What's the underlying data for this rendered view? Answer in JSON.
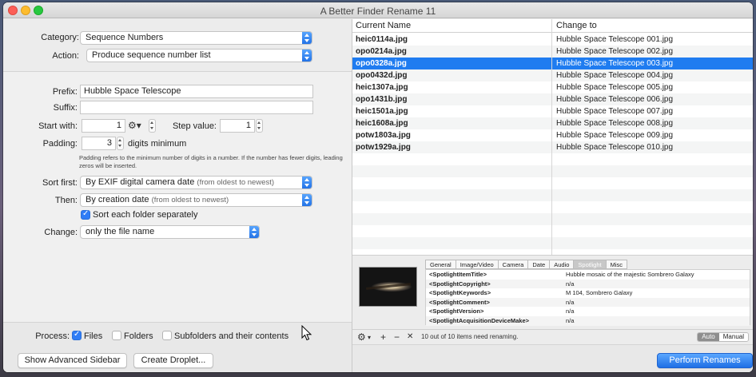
{
  "window": {
    "title": "A Better Finder Rename 11"
  },
  "top": {
    "category_label": "Category:",
    "category_value": "Sequence Numbers",
    "action_label": "Action:",
    "action_value": "Produce sequence number list"
  },
  "options": {
    "prefix_label": "Prefix:",
    "prefix_value": "Hubble Space Telescope",
    "suffix_label": "Suffix:",
    "suffix_value": "",
    "start_label": "Start with:",
    "start_value": "1",
    "step_label": "Step value:",
    "step_value": "1",
    "padding_label": "Padding:",
    "padding_value": "3",
    "padding_unit": "digits minimum",
    "padding_note": "Padding refers to the minimum number of digits in a number. If the number has fewer digits, leading zeros will be inserted.",
    "sort_first_label": "Sort first:",
    "sort_first_value": "By EXIF digital camera date",
    "sort_first_sub": "(from oldest to newest)",
    "then_label": "Then:",
    "then_value": "By creation date",
    "then_sub": "(from oldest to newest)",
    "sort_folder_label": "Sort each folder separately",
    "sort_folder_checked": true,
    "change_label": "Change:",
    "change_value": "only the file name"
  },
  "process": {
    "label": "Process:",
    "files_label": "Files",
    "files_checked": true,
    "folders_label": "Folders",
    "folders_checked": false,
    "subfolders_label": "Subfolders and their contents",
    "subfolders_checked": false
  },
  "buttons": {
    "advanced_sidebar": "Show Advanced Sidebar",
    "create_droplet": "Create Droplet...",
    "perform": "Perform Renames"
  },
  "table": {
    "col_current": "Current Name",
    "col_change": "Change to",
    "rows": [
      {
        "current": "heic0114a.jpg",
        "change": "Hubble Space Telescope 001.jpg"
      },
      {
        "current": "opo0214a.jpg",
        "change": "Hubble Space Telescope 002.jpg"
      },
      {
        "current": "opo0328a.jpg",
        "change": "Hubble Space Telescope 003.jpg"
      },
      {
        "current": "opo0432d.jpg",
        "change": "Hubble Space Telescope 004.jpg"
      },
      {
        "current": "heic1307a.jpg",
        "change": "Hubble Space Telescope 005.jpg"
      },
      {
        "current": "opo1431b.jpg",
        "change": "Hubble Space Telescope 006.jpg"
      },
      {
        "current": "heic1501a.jpg",
        "change": "Hubble Space Telescope 007.jpg"
      },
      {
        "current": "heic1608a.jpg",
        "change": "Hubble Space Telescope 008.jpg"
      },
      {
        "current": "potw1803a.jpg",
        "change": "Hubble Space Telescope 009.jpg"
      },
      {
        "current": "potw1929a.jpg",
        "change": "Hubble Space Telescope 010.jpg"
      }
    ],
    "selected_index": 2
  },
  "preview": {
    "tabs": [
      "General",
      "Image/Video",
      "Camera",
      "Date",
      "Audio",
      "Spotlight",
      "Misc"
    ],
    "active_tab": "Spotlight",
    "fields": [
      {
        "key": "<SpotlightItemTitle>",
        "value": "Hubble mosaic of the majestic Sombrero Galaxy"
      },
      {
        "key": "<SpotlightCopyright>",
        "value": "n/a"
      },
      {
        "key": "<SpotlightKeywords>",
        "value": "M 104, Sombrero Galaxy"
      },
      {
        "key": "<SpotlightComment>",
        "value": "n/a"
      },
      {
        "key": "<SpotlightVersion>",
        "value": "n/a"
      },
      {
        "key": "<SpotlightAcquisitionDeviceMake>",
        "value": "n/a"
      }
    ]
  },
  "status": {
    "text": "10 out of 10 items need renaming.",
    "mode_auto": "Auto",
    "mode_manual": "Manual",
    "mode_selected": "Auto"
  },
  "icons": {
    "gear": "⚙",
    "add": "+",
    "remove": "−",
    "clear": "✕"
  },
  "colors": {
    "accent": "#1f7cf0",
    "selection": "#1f7cf0"
  }
}
